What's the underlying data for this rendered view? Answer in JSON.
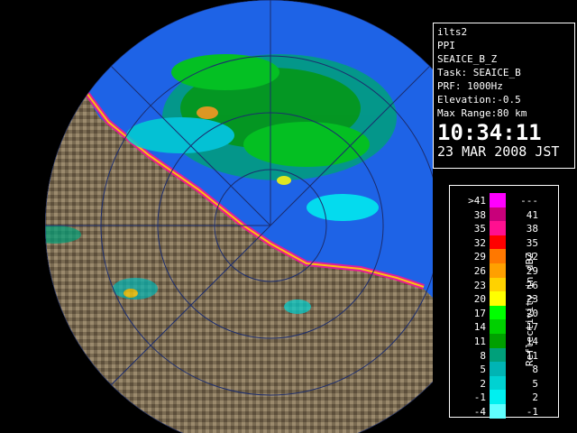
{
  "info": {
    "site": "ilts2",
    "mode": "PPI",
    "product": "SEAICE_B_Z",
    "task": "Task: SEAICE_B",
    "prf": "PRF: 1000Hz",
    "elevation": "Elevation:-0.5",
    "max_range": "Max Range:80 km",
    "time": "10:34:11",
    "date": "23 MAR 2008 JST"
  },
  "legend": {
    "unit_label": "Reflectivity in dBZ",
    "rows": [
      {
        "lo": ">41",
        "hi": "---",
        "color": "#ff00ff"
      },
      {
        "lo": "38",
        "hi": "41",
        "color": "#c8007a"
      },
      {
        "lo": "35",
        "hi": "38",
        "color": "#ff1090"
      },
      {
        "lo": "32",
        "hi": "35",
        "color": "#ff0000"
      },
      {
        "lo": "29",
        "hi": "32",
        "color": "#ff7800"
      },
      {
        "lo": "26",
        "hi": "29",
        "color": "#ffa000"
      },
      {
        "lo": "23",
        "hi": "26",
        "color": "#ffd200"
      },
      {
        "lo": "20",
        "hi": "23",
        "color": "#ffff00"
      },
      {
        "lo": "17",
        "hi": "20",
        "color": "#00ff00"
      },
      {
        "lo": "14",
        "hi": "17",
        "color": "#00d000"
      },
      {
        "lo": "11",
        "hi": "14",
        "color": "#00a000"
      },
      {
        "lo": "8",
        "hi": "11",
        "color": "#00a07a"
      },
      {
        "lo": "5",
        "hi": "8",
        "color": "#00b4b4"
      },
      {
        "lo": "2",
        "hi": "5",
        "color": "#00d2d2"
      },
      {
        "lo": "-1",
        "hi": "2",
        "color": "#00f0f0"
      },
      {
        "lo": "-4",
        "hi": "-1",
        "color": "#60ffff"
      }
    ]
  },
  "map_colors": {
    "sea": "#1e63e6",
    "land": "#7a6b52",
    "background": "#000000"
  }
}
